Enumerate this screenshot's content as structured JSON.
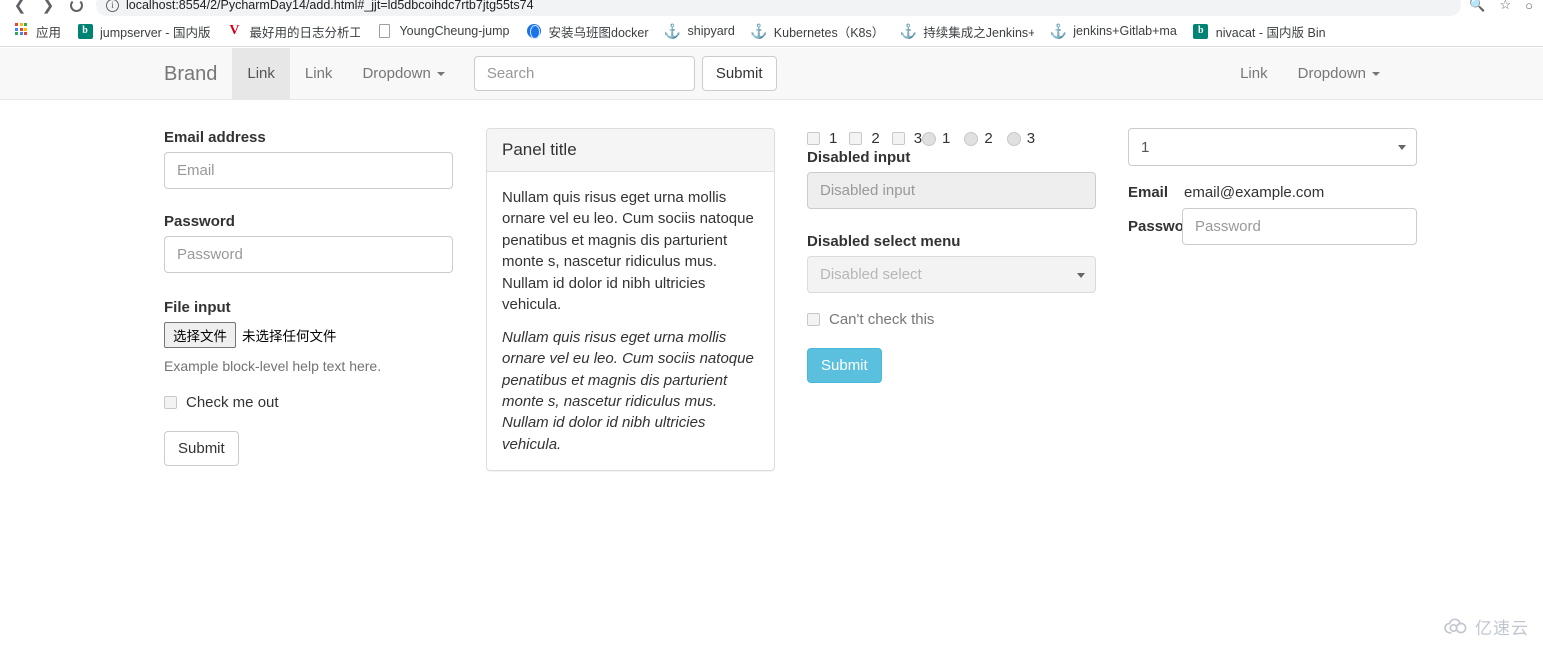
{
  "browser": {
    "url": "localhost:8554/2/PycharmDay14/add.html#_jjt=ld5dbcoihdc7rtb7jtg55ts74",
    "icons": {
      "back": "back-arrow-icon",
      "forward": "forward-arrow-icon",
      "reload": "reload-icon",
      "site_info": "site-info-icon",
      "search": "search-icon",
      "bookmark": "star-icon",
      "profile": "profile-icon"
    },
    "bookmarks": [
      {
        "label": "应用",
        "icon": "apps-grid-icon"
      },
      {
        "label": "jumpserver - 国内版",
        "icon": "bing-icon"
      },
      {
        "label": "最好用的日志分析工",
        "icon": "v-logo-icon"
      },
      {
        "label": "YoungCheung-jump",
        "icon": "document-icon"
      },
      {
        "label": "安装乌班图docker",
        "icon": "globe-icon"
      },
      {
        "label": "shipyard",
        "icon": "anchor-icon"
      },
      {
        "label": "Kubernetes（K8s）",
        "icon": "anchor-icon"
      },
      {
        "label": "持续集成之Jenkins+",
        "icon": "anchor-icon"
      },
      {
        "label": "jenkins+Gitlab+ma",
        "icon": "anchor-icon"
      },
      {
        "label": "nivacat - 国内版 Bin",
        "icon": "bing-icon"
      }
    ]
  },
  "navbar": {
    "brand": "Brand",
    "links": [
      {
        "label": "Link",
        "active": true
      },
      {
        "label": "Link",
        "active": false
      }
    ],
    "dropdown_label": "Dropdown",
    "search_placeholder": "Search",
    "search_value": "",
    "submit_label": "Submit",
    "right_link": "Link",
    "right_dropdown": "Dropdown"
  },
  "left_form": {
    "email_label": "Email address",
    "email_placeholder": "Email",
    "email_value": "",
    "password_label": "Password",
    "password_placeholder": "Password",
    "password_value": "",
    "file_label": "File input",
    "file_button": "选择文件",
    "file_status": "未选择任何文件",
    "help_text": "Example block-level help text here.",
    "checkbox_label": "Check me out",
    "submit_label": "Submit"
  },
  "panel": {
    "title": "Panel title",
    "body_1": "Nullam quis risus eget urna mollis ornare vel eu leo. Cum sociis natoque penatibus et magnis dis parturient monte s, nascetur ridiculus mus. Nullam id dolor id nibh ultricies vehicula.",
    "body_2": "Nullam quis risus eget urna mollis ornare vel eu leo. Cum sociis natoque penatibus et magnis dis parturient monte s, nascetur ridiculus mus. Nullam id dolor id nibh ultricies vehicula."
  },
  "third_col": {
    "checkbox_labels": [
      "1",
      "2",
      "3"
    ],
    "radio_labels": [
      "1",
      "2",
      "3"
    ],
    "disabled_input_label": "Disabled input",
    "disabled_input_placeholder": "Disabled input",
    "disabled_select_label": "Disabled select menu",
    "disabled_select_value": "Disabled select",
    "disabled_checkbox_label": "Can't check this",
    "submit_label": "Submit"
  },
  "right_col": {
    "select_value": "1",
    "email_label": "Email",
    "email_static": "email@example.com",
    "password_label": "Password",
    "password_placeholder": "Password",
    "password_value": ""
  },
  "watermark": {
    "text": "亿速云",
    "icon": "cloud-logo-icon"
  },
  "colors": {
    "navbar_bg": "#f8f8f8",
    "navbar_active": "#e7e7e7",
    "primary_button": "#5bc0de",
    "border": "#cccccc",
    "muted_text": "#777777"
  }
}
